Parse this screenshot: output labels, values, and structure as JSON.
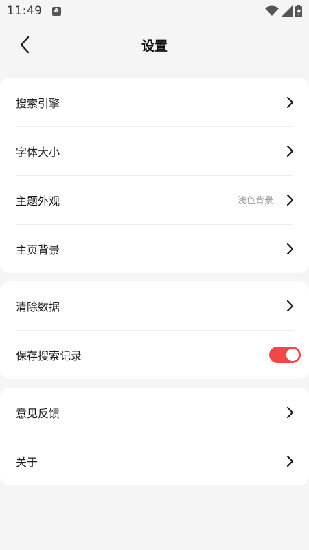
{
  "status_bar": {
    "time": "11:49",
    "app_icon_letter": "A",
    "icons": [
      "wifi-icon",
      "signal-icon",
      "battery-charging-icon"
    ]
  },
  "header": {
    "title": "设置",
    "back_icon": "chevron-left-icon"
  },
  "groups": [
    {
      "items": [
        {
          "label": "搜索引擎"
        },
        {
          "label": "字体大小"
        },
        {
          "label": "主题外观",
          "value": "浅色背景"
        },
        {
          "label": "主页背景"
        }
      ]
    },
    {
      "items": [
        {
          "label": "清除数据"
        },
        {
          "label": "保存搜索记录",
          "toggle_on": true
        }
      ]
    },
    {
      "items": [
        {
          "label": "意见反馈"
        },
        {
          "label": "关于"
        }
      ]
    }
  ],
  "colors": {
    "accent": "#f04848",
    "background": "#f5f5f5",
    "card": "#ffffff"
  }
}
